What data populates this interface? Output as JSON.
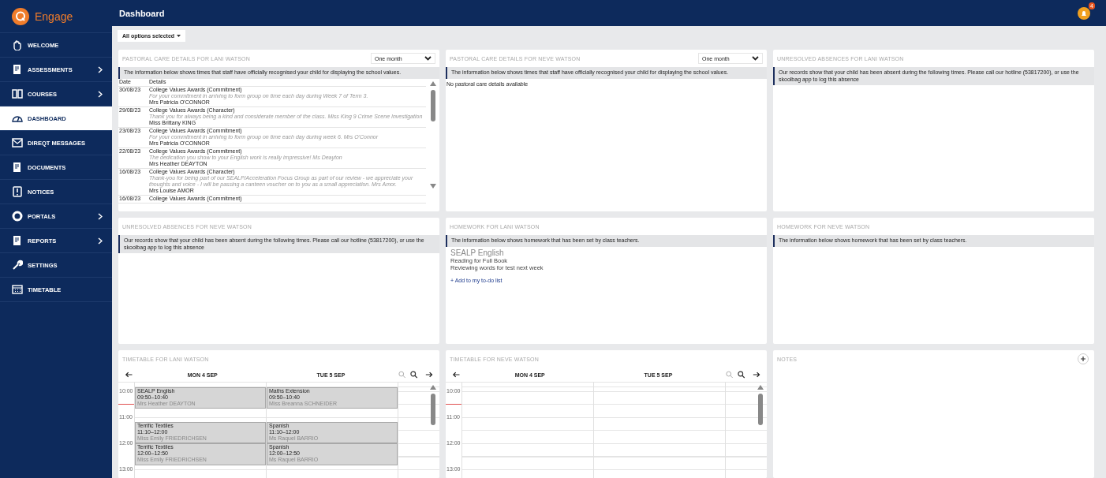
{
  "app": {
    "name": "Engage",
    "notifications": "4"
  },
  "sidebar": {
    "items": [
      {
        "label": "WELCOME",
        "selected": false,
        "has_submenu": false
      },
      {
        "label": "ASSESSMENTS",
        "selected": false,
        "has_submenu": true
      },
      {
        "label": "COURSES",
        "selected": false,
        "has_submenu": true
      },
      {
        "label": "DASHBOARD",
        "selected": true,
        "has_submenu": false
      },
      {
        "label": "DIREQT MESSAGES",
        "selected": false,
        "has_submenu": false
      },
      {
        "label": "DOCUMENTS",
        "selected": false,
        "has_submenu": false
      },
      {
        "label": "NOTICES",
        "selected": false,
        "has_submenu": false
      },
      {
        "label": "PORTALS",
        "selected": false,
        "has_submenu": true
      },
      {
        "label": "REPORTS",
        "selected": false,
        "has_submenu": true
      },
      {
        "label": "SETTINGS",
        "selected": false,
        "has_submenu": false
      },
      {
        "label": "TIMETABLE",
        "selected": false,
        "has_submenu": false
      }
    ]
  },
  "header": {
    "title": "Dashboard"
  },
  "filter": {
    "label": "All options selected"
  },
  "cards": [
    {
      "kind": "pastoral",
      "title": "PASTORAL CARE DETAILS FOR LANI WATSON",
      "period": "One month",
      "info": "The information below shows times that staff have officially recognised your child for displaying the school values.",
      "columns": [
        "Date",
        "Details"
      ],
      "rows": [
        {
          "date": "30/08/23",
          "award": "College Values Awards (Commitment)",
          "comment": "For your commitment in arriving to form group on time each day during Week 7 of Term 3.",
          "staff": "Mrs Patricia O'CONNOR"
        },
        {
          "date": "29/08/23",
          "award": "College Values Awards (Character)",
          "comment": "Thank you for always being a kind and considerate member of the class. Miss King 9 Crime Scene Investigation",
          "staff": "Miss Brittany KING"
        },
        {
          "date": "23/08/23",
          "award": "College Values Awards (Commitment)",
          "comment": "For your commitment in arriving to form group on time each day during week 6. Mrs O'Connor",
          "staff": "Mrs Patricia O'CONNOR"
        },
        {
          "date": "22/08/23",
          "award": "College Values Awards (Commitment)",
          "comment": "The dedication you show to your English work is really impressive! Ms Deayton",
          "staff": "Mrs Heather DEAYTON"
        },
        {
          "date": "16/08/23",
          "award": "College Values Awards (Character)",
          "comment": "Thank-you for being part of our SEALP/Acceleration Focus Group as part of our review - we appreciate your thoughts and voice - I will be passing a canteen voucher on to you as a small appreciation. Mrs Amor.",
          "staff": "Mrs Louise AMOR"
        },
        {
          "date": "16/08/23",
          "award": "College Values Awards (Commitment)"
        }
      ]
    },
    {
      "kind": "pastoral",
      "title": "PASTORAL CARE DETAILS FOR NEVE WATSON",
      "period": "One month",
      "info": "The information below shows times that staff have officially recognised your child for displaying the school values.",
      "empty": "No pastoral care details available"
    },
    {
      "kind": "info",
      "title": "UNRESOLVED ABSENCES FOR LANI WATSON",
      "info": "Our records show that your child has been absent during the following times. Please call our hotline (53817200), or use the skoolbag app to log this absence"
    },
    {
      "kind": "info",
      "title": "UNRESOLVED ABSENCES FOR NEVE WATSON",
      "info": "Our records show that your child has been absent during the following times. Please call our hotline (53817200), or use the skoolbag app to log this absence"
    },
    {
      "kind": "homework",
      "title": "HOMEWORK FOR LANI WATSON",
      "info": "The information below shows homework that has been set by class teachers.",
      "items": [
        {
          "subject": "SEALP English",
          "task": "Reading for Full Book",
          "detail": "Reviewing words for test next week",
          "action": "+ Add to my to-do list"
        }
      ]
    },
    {
      "kind": "homework",
      "title": "HOMEWORK FOR NEVE WATSON",
      "info": "The information below shows homework that has been set by class teachers."
    },
    {
      "kind": "timetable",
      "title": "TIMETABLE FOR LANI WATSON",
      "days": [
        {
          "label": "MON 4 SEP",
          "entries": [
            {
              "kind": "lesson",
              "subject": "SEALP English",
              "time": "09:50–10:40",
              "teacher": "Mrs Heather DEAYTON"
            },
            {
              "kind": "short-break"
            },
            {
              "kind": "lesson",
              "subject": "Terrific Textiles",
              "time": "11:10–12:00",
              "teacher": "Miss Emily FRIEDRICHSEN"
            },
            {
              "kind": "lesson",
              "subject": "Terrific Textiles",
              "time": "12:00–12:50",
              "teacher": "Miss Emily FRIEDRICHSEN"
            }
          ]
        },
        {
          "label": "TUE 5 SEP",
          "entries": [
            {
              "kind": "lesson",
              "subject": "Maths Extension",
              "time": "09:50–10:40",
              "teacher": "Miss Breanna SCHNEIDER"
            },
            {
              "kind": "short-break"
            },
            {
              "kind": "lesson",
              "subject": "Spanish",
              "time": "11:10–12:00",
              "teacher": "Ms Raquel BARRIO"
            },
            {
              "kind": "lesson",
              "subject": "Spanish",
              "time": "12:00–12:50",
              "teacher": "Ms Raquel BARRIO"
            }
          ]
        }
      ],
      "hours": [
        "10:00",
        "11:00",
        "12:00",
        "13:00"
      ]
    },
    {
      "kind": "timetable",
      "title": "TIMETABLE FOR NEVE WATSON",
      "days": [
        {
          "label": "MON 4 SEP"
        },
        {
          "label": "TUE 5 SEP"
        }
      ],
      "hours": [
        "10:00",
        "11:00",
        "12:00",
        "13:00"
      ]
    },
    {
      "kind": "notes",
      "title": "NOTES"
    }
  ]
}
